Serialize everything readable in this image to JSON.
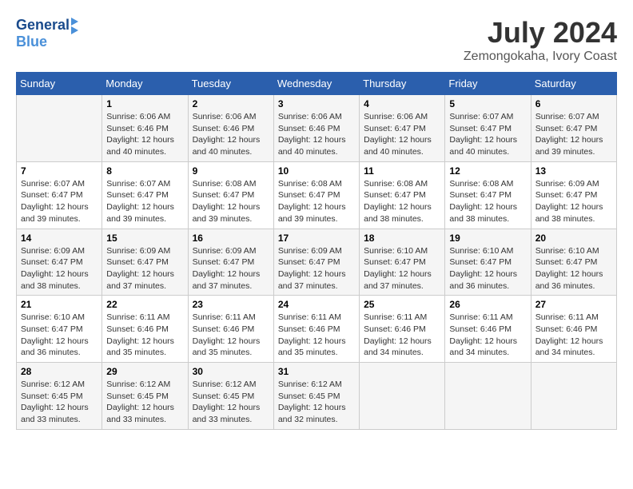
{
  "logo": {
    "line1": "General",
    "line2": "Blue"
  },
  "title": "July 2024",
  "location": "Zemongokaha, Ivory Coast",
  "headers": [
    "Sunday",
    "Monday",
    "Tuesday",
    "Wednesday",
    "Thursday",
    "Friday",
    "Saturday"
  ],
  "weeks": [
    [
      {
        "day": "",
        "info": ""
      },
      {
        "day": "1",
        "info": "Sunrise: 6:06 AM\nSunset: 6:46 PM\nDaylight: 12 hours\nand 40 minutes."
      },
      {
        "day": "2",
        "info": "Sunrise: 6:06 AM\nSunset: 6:46 PM\nDaylight: 12 hours\nand 40 minutes."
      },
      {
        "day": "3",
        "info": "Sunrise: 6:06 AM\nSunset: 6:46 PM\nDaylight: 12 hours\nand 40 minutes."
      },
      {
        "day": "4",
        "info": "Sunrise: 6:06 AM\nSunset: 6:47 PM\nDaylight: 12 hours\nand 40 minutes."
      },
      {
        "day": "5",
        "info": "Sunrise: 6:07 AM\nSunset: 6:47 PM\nDaylight: 12 hours\nand 40 minutes."
      },
      {
        "day": "6",
        "info": "Sunrise: 6:07 AM\nSunset: 6:47 PM\nDaylight: 12 hours\nand 39 minutes."
      }
    ],
    [
      {
        "day": "7",
        "info": "Sunrise: 6:07 AM\nSunset: 6:47 PM\nDaylight: 12 hours\nand 39 minutes."
      },
      {
        "day": "8",
        "info": "Sunrise: 6:07 AM\nSunset: 6:47 PM\nDaylight: 12 hours\nand 39 minutes."
      },
      {
        "day": "9",
        "info": "Sunrise: 6:08 AM\nSunset: 6:47 PM\nDaylight: 12 hours\nand 39 minutes."
      },
      {
        "day": "10",
        "info": "Sunrise: 6:08 AM\nSunset: 6:47 PM\nDaylight: 12 hours\nand 39 minutes."
      },
      {
        "day": "11",
        "info": "Sunrise: 6:08 AM\nSunset: 6:47 PM\nDaylight: 12 hours\nand 38 minutes."
      },
      {
        "day": "12",
        "info": "Sunrise: 6:08 AM\nSunset: 6:47 PM\nDaylight: 12 hours\nand 38 minutes."
      },
      {
        "day": "13",
        "info": "Sunrise: 6:09 AM\nSunset: 6:47 PM\nDaylight: 12 hours\nand 38 minutes."
      }
    ],
    [
      {
        "day": "14",
        "info": "Sunrise: 6:09 AM\nSunset: 6:47 PM\nDaylight: 12 hours\nand 38 minutes."
      },
      {
        "day": "15",
        "info": "Sunrise: 6:09 AM\nSunset: 6:47 PM\nDaylight: 12 hours\nand 37 minutes."
      },
      {
        "day": "16",
        "info": "Sunrise: 6:09 AM\nSunset: 6:47 PM\nDaylight: 12 hours\nand 37 minutes."
      },
      {
        "day": "17",
        "info": "Sunrise: 6:09 AM\nSunset: 6:47 PM\nDaylight: 12 hours\nand 37 minutes."
      },
      {
        "day": "18",
        "info": "Sunrise: 6:10 AM\nSunset: 6:47 PM\nDaylight: 12 hours\nand 37 minutes."
      },
      {
        "day": "19",
        "info": "Sunrise: 6:10 AM\nSunset: 6:47 PM\nDaylight: 12 hours\nand 36 minutes."
      },
      {
        "day": "20",
        "info": "Sunrise: 6:10 AM\nSunset: 6:47 PM\nDaylight: 12 hours\nand 36 minutes."
      }
    ],
    [
      {
        "day": "21",
        "info": "Sunrise: 6:10 AM\nSunset: 6:47 PM\nDaylight: 12 hours\nand 36 minutes."
      },
      {
        "day": "22",
        "info": "Sunrise: 6:11 AM\nSunset: 6:46 PM\nDaylight: 12 hours\nand 35 minutes."
      },
      {
        "day": "23",
        "info": "Sunrise: 6:11 AM\nSunset: 6:46 PM\nDaylight: 12 hours\nand 35 minutes."
      },
      {
        "day": "24",
        "info": "Sunrise: 6:11 AM\nSunset: 6:46 PM\nDaylight: 12 hours\nand 35 minutes."
      },
      {
        "day": "25",
        "info": "Sunrise: 6:11 AM\nSunset: 6:46 PM\nDaylight: 12 hours\nand 34 minutes."
      },
      {
        "day": "26",
        "info": "Sunrise: 6:11 AM\nSunset: 6:46 PM\nDaylight: 12 hours\nand 34 minutes."
      },
      {
        "day": "27",
        "info": "Sunrise: 6:11 AM\nSunset: 6:46 PM\nDaylight: 12 hours\nand 34 minutes."
      }
    ],
    [
      {
        "day": "28",
        "info": "Sunrise: 6:12 AM\nSunset: 6:45 PM\nDaylight: 12 hours\nand 33 minutes."
      },
      {
        "day": "29",
        "info": "Sunrise: 6:12 AM\nSunset: 6:45 PM\nDaylight: 12 hours\nand 33 minutes."
      },
      {
        "day": "30",
        "info": "Sunrise: 6:12 AM\nSunset: 6:45 PM\nDaylight: 12 hours\nand 33 minutes."
      },
      {
        "day": "31",
        "info": "Sunrise: 6:12 AM\nSunset: 6:45 PM\nDaylight: 12 hours\nand 32 minutes."
      },
      {
        "day": "",
        "info": ""
      },
      {
        "day": "",
        "info": ""
      },
      {
        "day": "",
        "info": ""
      }
    ]
  ]
}
